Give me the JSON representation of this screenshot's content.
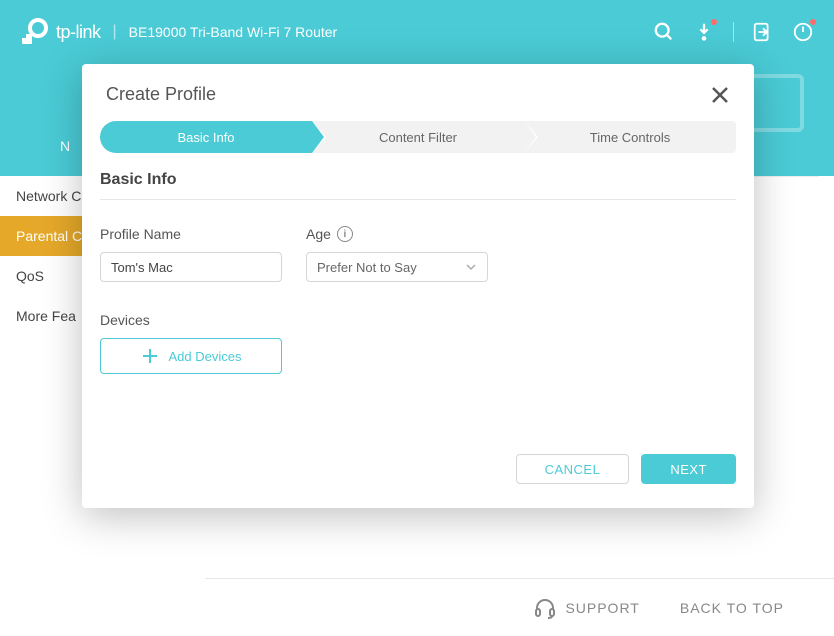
{
  "header": {
    "brand": "tp-link",
    "product": "BE19000 Tri-Band Wi-Fi 7 Router"
  },
  "nav": {
    "peek_label": "N"
  },
  "sidebar": {
    "items": [
      {
        "label": "Network C"
      },
      {
        "label": "Parental C"
      },
      {
        "label": "QoS"
      },
      {
        "label": "More Fea"
      }
    ]
  },
  "modal": {
    "title": "Create Profile",
    "steps": [
      "Basic Info",
      "Content Filter",
      "Time Controls"
    ],
    "section_title": "Basic Info",
    "profile_name_label": "Profile Name",
    "profile_name_value": "Tom's Mac",
    "age_label": "Age",
    "age_value": "Prefer Not to Say",
    "devices_label": "Devices",
    "add_devices_label": "Add Devices",
    "cancel": "CANCEL",
    "next": "NEXT"
  },
  "footer": {
    "support": "SUPPORT",
    "back_to_top": "BACK TO TOP"
  }
}
